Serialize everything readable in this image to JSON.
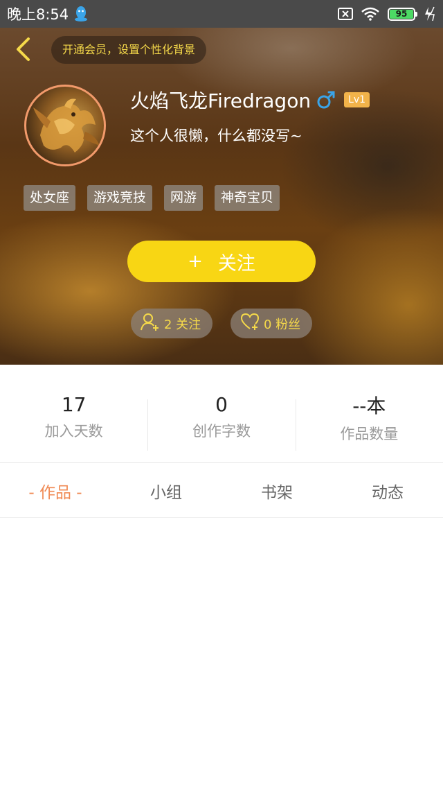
{
  "status_bar": {
    "time": "晚上8:54",
    "battery": "95"
  },
  "header": {
    "vip_banner": "开通会员，设置个性化背景",
    "username": "火焰飞龙Firedragon",
    "level": "Lv1",
    "signature": "这个人很懒，什么都没写~",
    "tags": [
      "处女座",
      "游戏竞技",
      "网游",
      "神奇宝贝"
    ],
    "follow_button": {
      "plus": "+",
      "label": "关注"
    },
    "following": "2 关注",
    "fans": "0 粉丝"
  },
  "stats": [
    {
      "value": "17",
      "label": "加入天数"
    },
    {
      "value": "0",
      "label": "创作字数"
    },
    {
      "value": "--本",
      "label": "作品数量"
    }
  ],
  "tabs": [
    {
      "label": "- 作品 -",
      "active": true
    },
    {
      "label": "小组",
      "active": false
    },
    {
      "label": "书架",
      "active": false
    },
    {
      "label": "动态",
      "active": false
    }
  ],
  "colors": {
    "accent_yellow": "#f8d614",
    "tab_active": "#f08a54",
    "gender_blue": "#3aa4e8",
    "level_badge": "#f2b34a"
  },
  "icons": {
    "status_app": "qq-penguin-icon",
    "back": "chevron-left-icon",
    "gender": "male-icon",
    "following": "add-user-icon",
    "fans": "heart-plus-icon"
  }
}
